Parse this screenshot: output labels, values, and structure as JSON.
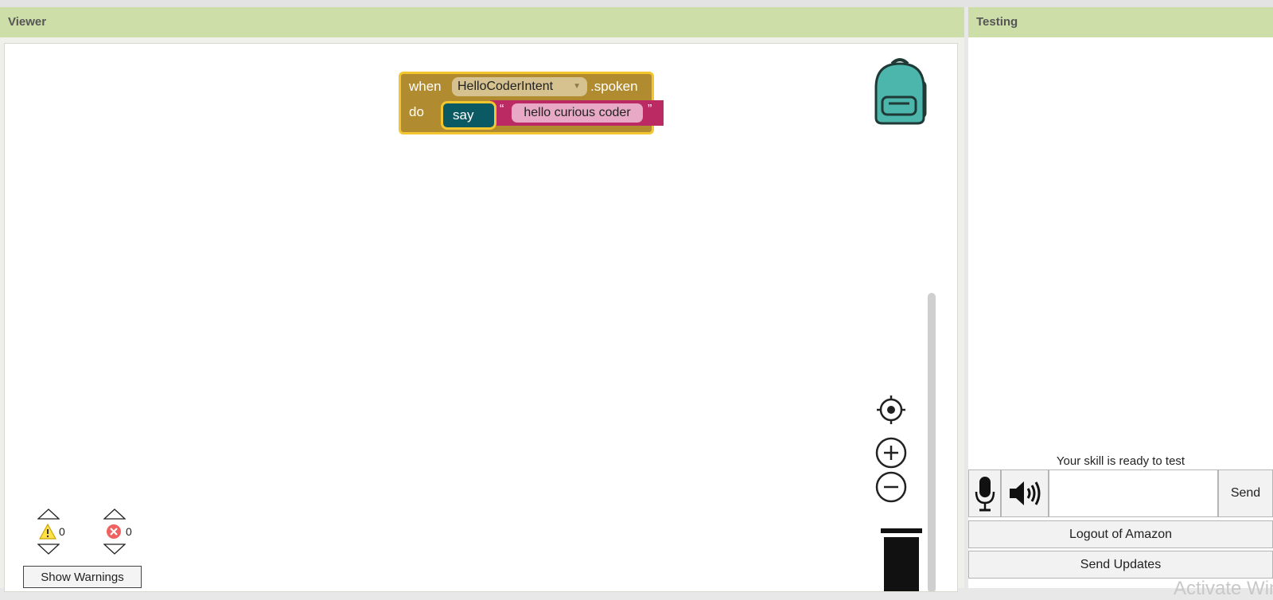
{
  "viewer": {
    "title": "Viewer"
  },
  "testing": {
    "title": "Testing"
  },
  "event_block": {
    "when_label": "when",
    "intent_name": "HelloCoderIntent",
    "spoken_label": ".spoken",
    "do_label": "do"
  },
  "say_block": {
    "label": "say",
    "open_quote": "“",
    "text": "hello curious coder",
    "close_quote": "”"
  },
  "warnings": {
    "warning_count": "0",
    "error_count": "0",
    "show_warnings_label": "Show Warnings"
  },
  "test_panel": {
    "status_text": "Your skill is ready to test",
    "send_label": "Send",
    "input_value": "",
    "logout_label": "Logout of Amazon",
    "send_updates_label": "Send Updates"
  },
  "watermark": "Activate Windows",
  "colors": {
    "header_bg": "#cddea9",
    "event_block": "#b18b2f",
    "block_highlight": "#f3c62f",
    "say_block": "#0b5a63",
    "string_block": "#bb2a62",
    "backpack": "#4db6ac"
  },
  "icons": [
    "backpack-icon",
    "recenter-icon",
    "zoom-in-icon",
    "zoom-out-icon",
    "trash-icon",
    "warning-icon",
    "error-icon",
    "microphone-icon",
    "speaker-icon"
  ]
}
